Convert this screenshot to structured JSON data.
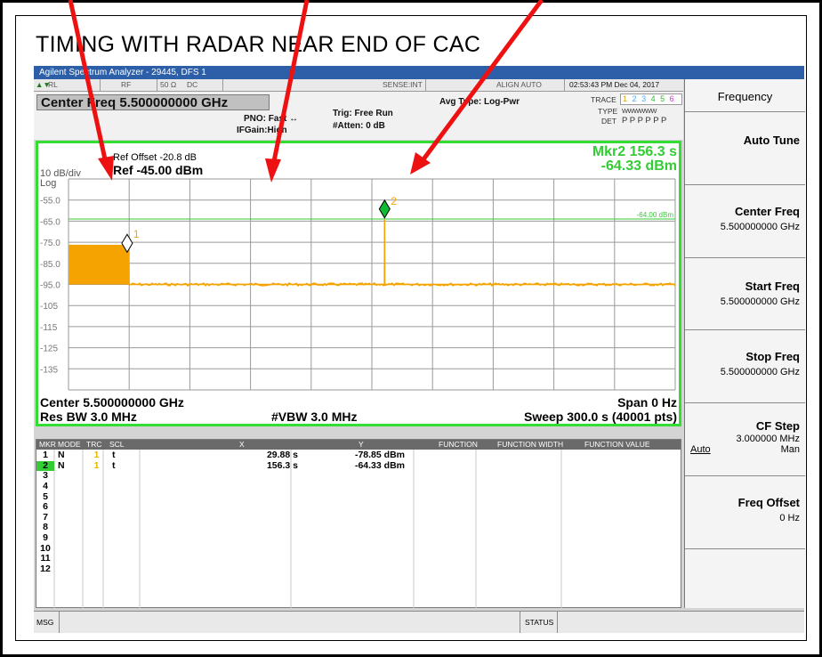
{
  "caption": "TIMING WITH RADAR NEAR END OF CAC",
  "window": {
    "title": "Agilent Spectrum Analyzer - 29445, DFS 1"
  },
  "status_row": {
    "rl": "RL",
    "rf": "RF",
    "ohm": "50 Ω",
    "dc": "DC",
    "sense": "SENSE:INT",
    "align": "ALIGN AUTO",
    "timestamp": "02:53:43 PM Dec 04, 2017"
  },
  "trace_info": {
    "trace_label": "TRACE",
    "trace_nums": [
      "1",
      "2",
      "3",
      "4",
      "5",
      "6"
    ],
    "type_label": "TYPE",
    "type_val": "WWWWWW",
    "det_label": "DET",
    "det_val": "P P P P P P"
  },
  "settings": {
    "center_freq_label": "Center Freq  5.500000000 GHz",
    "pno": "PNO: Fast ↔",
    "ifgain": "IFGain:High",
    "trig": "Trig: Free Run",
    "atten": "#Atten: 0 dB",
    "avg_type": "Avg Type: Log-Pwr"
  },
  "plot": {
    "ref_offset": "Ref Offset -20.8 dB",
    "ref_level": "Ref -45.00 dBm",
    "scale": "10 dB/div",
    "log": "Log",
    "mkr_readout_1": "Mkr2 156.3 s",
    "mkr_readout_2": "-64.33 dBm",
    "y_ticks": [
      "-55.0",
      "-65.0",
      "-75.0",
      "-85.0",
      "-95.0",
      "-105",
      "-115",
      "-125",
      "-135"
    ],
    "threshold_label": "-64.00 dBm",
    "marker1_label": "1",
    "marker2_label": "2",
    "center_footer": "Center 5.500000000 GHz",
    "span_footer": "Span 0 Hz",
    "rbw_footer": "Res BW 3.0 MHz",
    "vbw_footer": "#VBW 3.0 MHz",
    "sweep_footer": "Sweep  300.0 s (40001 pts)"
  },
  "chart_data": {
    "type": "line",
    "title": "",
    "xlabel": "",
    "ylabel": "",
    "xlim": [
      0,
      300.0
    ],
    "ylim": [
      -145,
      -45
    ],
    "threshold_dbm": -64.0,
    "series": [
      {
        "x": [
          0,
          29.8,
          29.9,
          156.2,
          156.3,
          156.4,
          300.0
        ],
        "y": [
          -76.5,
          -76.5,
          -95.0,
          -95.0,
          -64.33,
          -95.0,
          -95.0
        ]
      }
    ],
    "markers": [
      {
        "label": "1",
        "x_s": 29.88,
        "y_dbm": -78.85
      },
      {
        "label": "2",
        "x_s": 156.3,
        "y_dbm": -64.33
      }
    ],
    "colors": {
      "trace": "#f5a300",
      "threshold": "#33cc33",
      "grid": "#9a9a9a",
      "marker1": "#ffffff",
      "marker2": "#11bb33"
    }
  },
  "marker_table": {
    "headers": [
      "MKR",
      "MODE",
      "TRC",
      "SCL",
      "X",
      "Y",
      "FUNCTION",
      "FUNCTION WIDTH",
      "FUNCTION VALUE"
    ],
    "rows": [
      {
        "mkr": "1",
        "mode": "N",
        "trc": "1",
        "scl": "t",
        "x": "29.88 s",
        "y": "-78.85 dBm"
      },
      {
        "mkr": "2",
        "mode": "N",
        "trc": "1",
        "scl": "t",
        "x": "156.3 s",
        "y": "-64.33 dBm"
      },
      {
        "mkr": "3"
      },
      {
        "mkr": "4"
      },
      {
        "mkr": "5"
      },
      {
        "mkr": "6"
      },
      {
        "mkr": "7"
      },
      {
        "mkr": "8"
      },
      {
        "mkr": "9"
      },
      {
        "mkr": "10"
      },
      {
        "mkr": "11"
      },
      {
        "mkr": "12"
      }
    ]
  },
  "softkeys": {
    "menu_title": "Frequency",
    "auto_tune": "Auto Tune",
    "center_freq": "Center Freq",
    "center_freq_val": "5.500000000 GHz",
    "start_freq": "Start Freq",
    "start_freq_val": "5.500000000 GHz",
    "stop_freq": "Stop Freq",
    "stop_freq_val": "5.500000000 GHz",
    "cf_step": "CF Step",
    "cf_step_val": "3.000000 MHz",
    "cf_auto": "Auto",
    "cf_man": "Man",
    "freq_offset": "Freq Offset",
    "freq_offset_val": "0 Hz"
  },
  "msg_bar": {
    "msg": "MSG",
    "status": "STATUS"
  }
}
